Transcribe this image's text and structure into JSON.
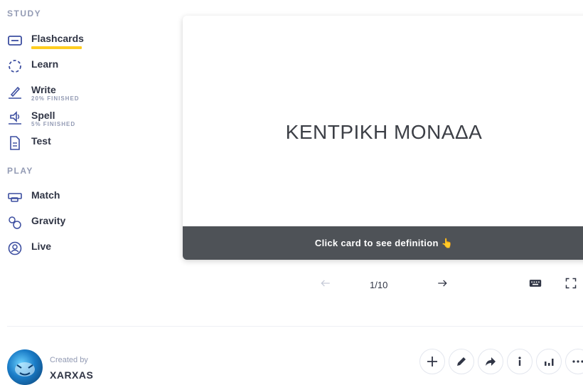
{
  "sidebar": {
    "study_heading": "STUDY",
    "play_heading": "PLAY",
    "study_items": [
      {
        "label": "Flashcards",
        "sub": "",
        "icon": "flashcards-icon"
      },
      {
        "label": "Learn",
        "sub": "",
        "icon": "learn-icon"
      },
      {
        "label": "Write",
        "sub": "20% FINISHED",
        "icon": "write-icon"
      },
      {
        "label": "Spell",
        "sub": "5% FINISHED",
        "icon": "spell-icon"
      },
      {
        "label": "Test",
        "sub": "",
        "icon": "test-icon"
      }
    ],
    "play_items": [
      {
        "label": "Match",
        "icon": "match-icon"
      },
      {
        "label": "Gravity",
        "icon": "gravity-icon"
      },
      {
        "label": "Live",
        "icon": "live-icon"
      }
    ]
  },
  "card": {
    "term": "ΚΕΝΤΡΙΚΗ ΜΟΝΑΔΑ",
    "hint": "Click card to see definition 👆"
  },
  "controls": {
    "counter": "1/10",
    "prev_icon": "arrow-left-icon",
    "next_icon": "arrow-right-icon",
    "keyboard_icon": "keyboard-icon",
    "fullscreen_icon": "fullscreen-icon"
  },
  "footer": {
    "created_by_label": "Created by",
    "author": "XARXAS",
    "actions": [
      "add-icon",
      "edit-icon",
      "share-icon",
      "info-icon",
      "stats-icon",
      "more-icon"
    ]
  },
  "colors": {
    "accent": "#ffcd1f",
    "card_footer": "#4e5257",
    "muted": "#939bb4",
    "text": "#303545"
  }
}
